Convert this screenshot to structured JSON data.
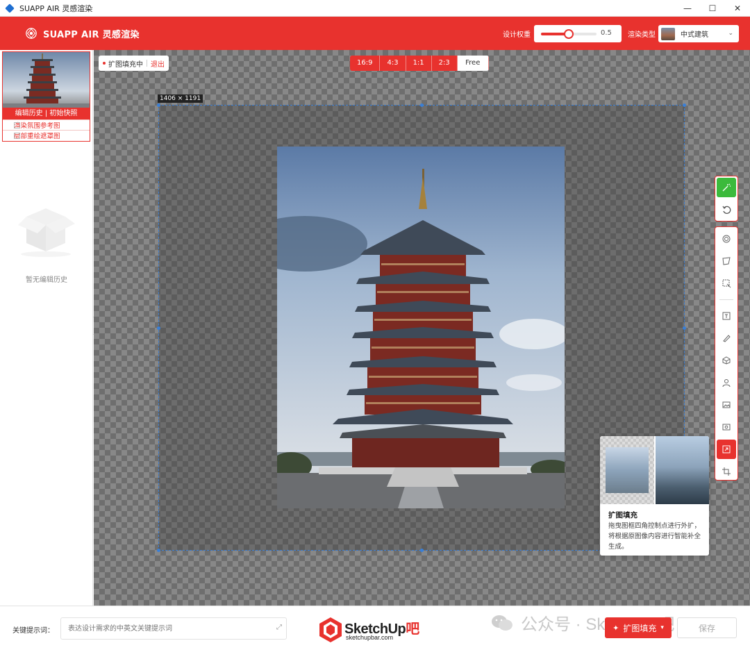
{
  "window": {
    "title": "SUAPP AIR 灵感渲染",
    "controls": [
      "—",
      "☐",
      "✕"
    ]
  },
  "header": {
    "brand": "SUAPP AIR 灵感渲染",
    "design_weight_label": "设计权重",
    "design_weight_value": "0.5",
    "design_weight_fraction": 0.5,
    "render_type_label": "渲染类型",
    "render_type_value": "中式建筑",
    "accent_color": "#e8322e"
  },
  "sidebar": {
    "history_tab": "编辑历史 | 初始快照",
    "options": [
      "渲染氛围参考图",
      "局部重绘遮罩图"
    ],
    "empty_text": "暂无编辑历史"
  },
  "canvas": {
    "mode_label": "扩图填充中",
    "exit_label": "退出",
    "ratios": [
      "16:9",
      "4:3",
      "1:1",
      "2:3",
      "Free"
    ],
    "dimensions": "1406 × 1191"
  },
  "toolbar": {
    "top_tools": [
      "magic-wand-icon",
      "undo-icon"
    ],
    "main_tools": [
      "target-icon",
      "lasso-icon",
      "select-region-icon",
      "text-box-icon",
      "brush-icon",
      "material-icon",
      "person-icon",
      "image-icon",
      "eye-icon",
      "expand-fill-icon",
      "crop-icon"
    ],
    "active_tool": "expand-fill-icon"
  },
  "tooltip": {
    "title": "扩图填充",
    "description": "拖曳图框四角控制点进行外扩，将根据原图像内容进行智能补全生成。"
  },
  "bottom": {
    "keyword_label": "关键提示词：",
    "keyword_placeholder": "表达设计需求的中英文关键提示词",
    "watermark_brand": "SketchUp",
    "watermark_brand_suffix": "吧",
    "watermark_url": "sketchupbar.com",
    "wechat_text": "公众号 · SketchUp吧",
    "expand_button": "扩图填充",
    "save_button": "保存"
  }
}
